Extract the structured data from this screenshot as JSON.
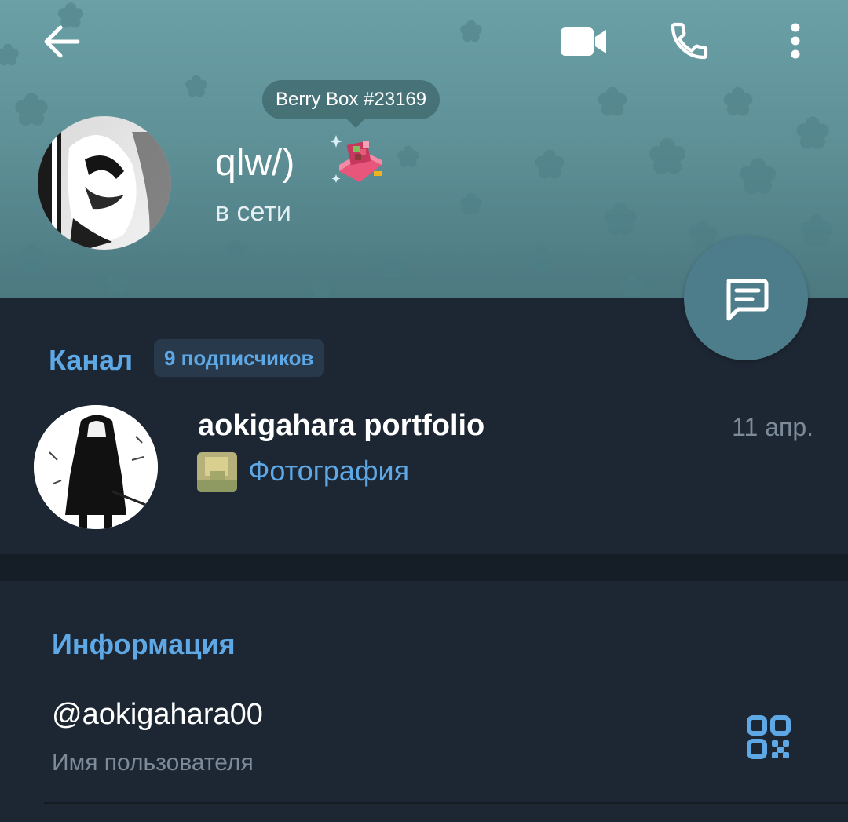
{
  "header": {
    "back_icon": "arrow-left-icon",
    "video_icon": "video-camera-icon",
    "call_icon": "phone-icon",
    "more_icon": "more-vertical-icon",
    "gift_tooltip": "Berry Box #23169",
    "profile_name": "qlw/)",
    "profile_status": "в сети",
    "gift_icon": "berry-box-gift-icon"
  },
  "fab": {
    "icon": "message-icon"
  },
  "channel": {
    "section_label": "Канал",
    "subscribers": "9 подписчиков",
    "name": "aokigahara portfolio",
    "date": "11 апр.",
    "last_message": "Фотография"
  },
  "info": {
    "section_label": "Информация",
    "username": "@aokigahara00",
    "username_caption": "Имя пользователя",
    "qr_icon": "qr-code-icon"
  },
  "colors": {
    "accent": "#5fa8e6",
    "background": "#1d2733",
    "header": "#6aa0a6",
    "fab": "#4d7c8a"
  }
}
